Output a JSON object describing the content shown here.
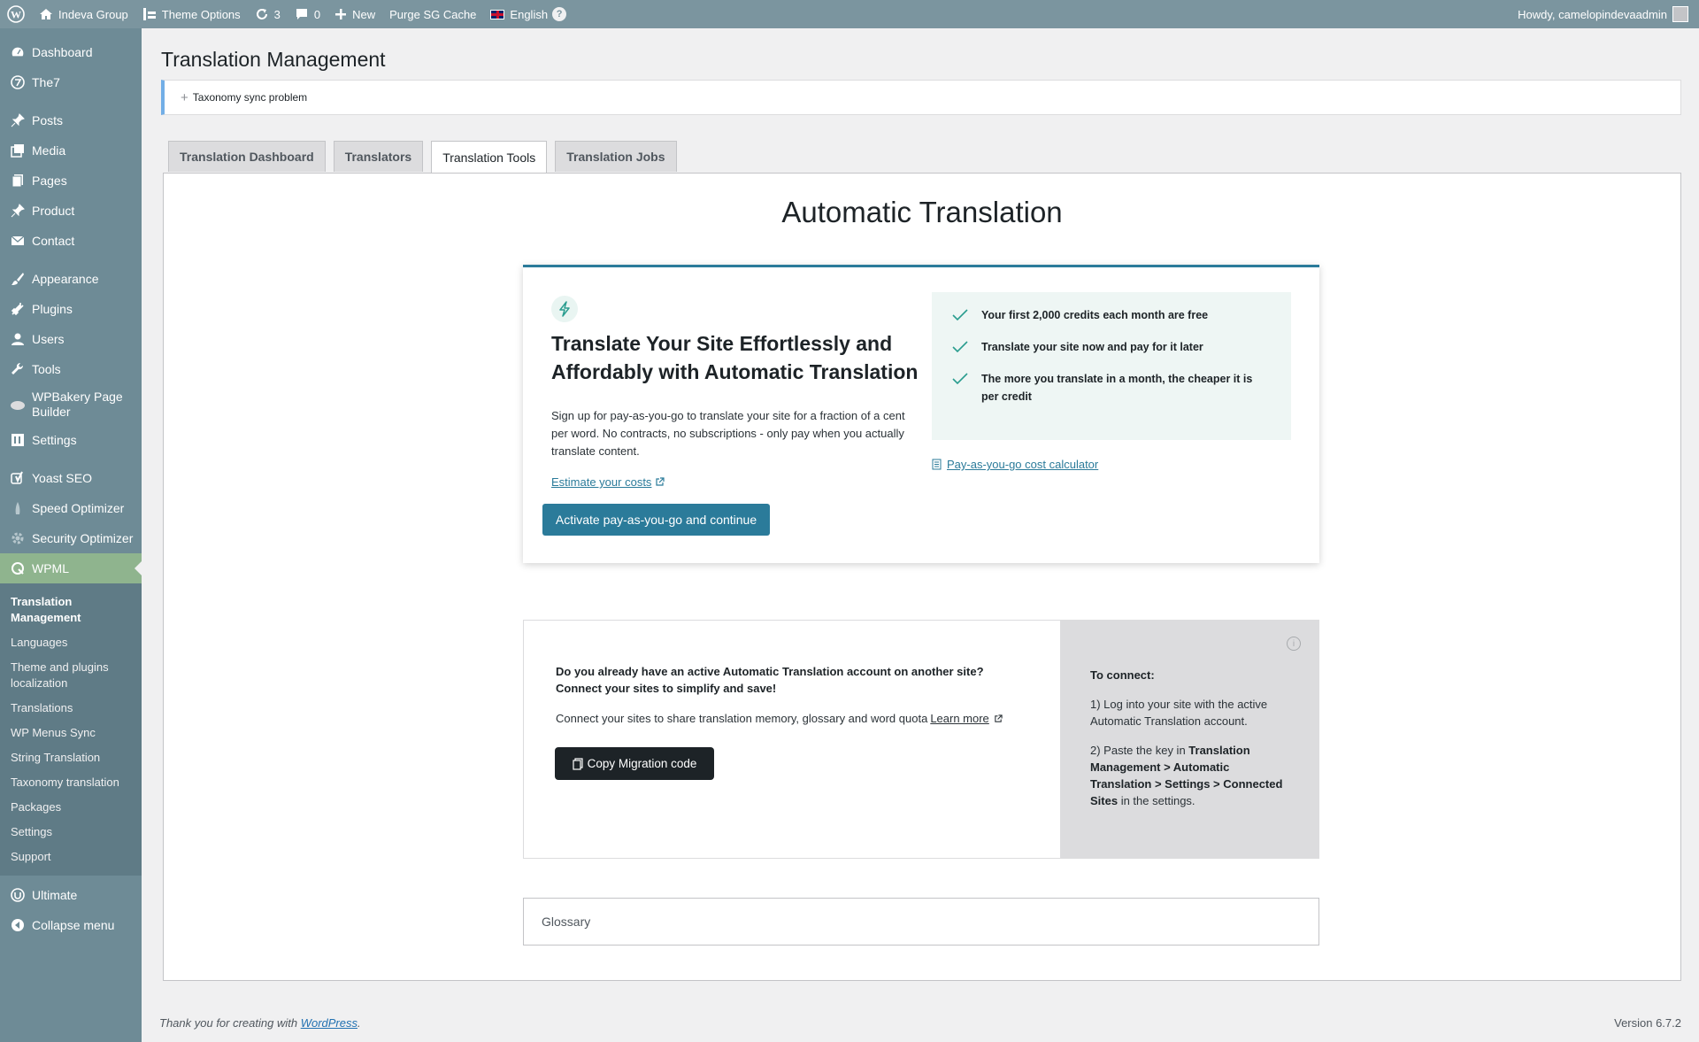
{
  "adminbar": {
    "site_name": "Indeva Group",
    "theme_options": "Theme Options",
    "updates_count": "3",
    "comments_count": "0",
    "new_label": "New",
    "purge_label": "Purge SG Cache",
    "language": "English",
    "language_help": "?",
    "howdy": "Howdy, camelopindevaadmin"
  },
  "sidebar": {
    "items": [
      {
        "label": "Dashboard",
        "icon": "dashboard-icon"
      },
      {
        "label": "The7",
        "icon": "the7-icon"
      },
      {
        "label": "Posts",
        "icon": "pin-icon"
      },
      {
        "label": "Media",
        "icon": "media-icon"
      },
      {
        "label": "Pages",
        "icon": "pages-icon"
      },
      {
        "label": "Product",
        "icon": "pin-icon"
      },
      {
        "label": "Contact",
        "icon": "mail-icon"
      },
      {
        "label": "Appearance",
        "icon": "brush-icon"
      },
      {
        "label": "Plugins",
        "icon": "plug-icon"
      },
      {
        "label": "Users",
        "icon": "user-icon"
      },
      {
        "label": "Tools",
        "icon": "wrench-icon"
      },
      {
        "label": "WPBakery Page Builder",
        "icon": "cloud-icon"
      },
      {
        "label": "Settings",
        "icon": "settings-icon"
      },
      {
        "label": "Yoast SEO",
        "icon": "yoast-icon"
      },
      {
        "label": "Speed Optimizer",
        "icon": "rocket-icon"
      },
      {
        "label": "Security Optimizer",
        "icon": "gear-icon"
      },
      {
        "label": "WPML",
        "icon": "wpml-icon"
      }
    ],
    "submenu": [
      "Translation Management",
      "Languages",
      "Theme and plugins localization",
      "Translations",
      "WP Menus Sync",
      "String Translation",
      "Taxonomy translation",
      "Packages",
      "Settings",
      "Support"
    ],
    "after": [
      {
        "label": "Ultimate",
        "icon": "shield-icon"
      },
      {
        "label": "Collapse menu",
        "icon": "collapse-icon"
      }
    ]
  },
  "page": {
    "title": "Translation Management",
    "notice": "Taxonomy sync problem",
    "tabs": [
      "Translation Dashboard",
      "Translators",
      "Translation Tools",
      "Translation Jobs"
    ],
    "active_tab": "Translation Tools"
  },
  "auto_translation": {
    "title": "Automatic Translation",
    "heading": "Translate Your Site Effortlessly and Affordably with Automatic Translation",
    "description": "Sign up for pay-as-you-go to translate your site for a fraction of a cent per word. No contracts, no subscriptions - only pay when you actually translate content.",
    "estimate_link": "Estimate your costs",
    "activate_button": "Activate pay-as-you-go and continue",
    "benefits": [
      "Your first 2,000 credits each month are free",
      "Translate your site now and pay for it later",
      "The more you translate in a month, the cheaper it is per credit"
    ],
    "calculator_link": "Pay-as-you-go cost calculator",
    "accent_color": "#2b7b9a"
  },
  "connect": {
    "question": "Do you already have an active Automatic Translation account on another site? Connect your sites to simplify and save!",
    "description": "Connect your sites to share translation memory, glossary and word quota",
    "learn_more": "Learn more",
    "copy_button": "Copy Migration code",
    "to_connect": "To connect:",
    "step1": "1) Log into your site with the active Automatic Translation account.",
    "step2_prefix": "2) Paste the key in",
    "step2_path": "Translation Management > Automatic Translation > Settings > Connected Sites",
    "step2_suffix": "in the settings."
  },
  "glossary": {
    "label": "Glossary"
  },
  "footer": {
    "thanks": "Thank you for creating with",
    "wp_link": "WordPress",
    "version": "Version 6.7.2"
  }
}
